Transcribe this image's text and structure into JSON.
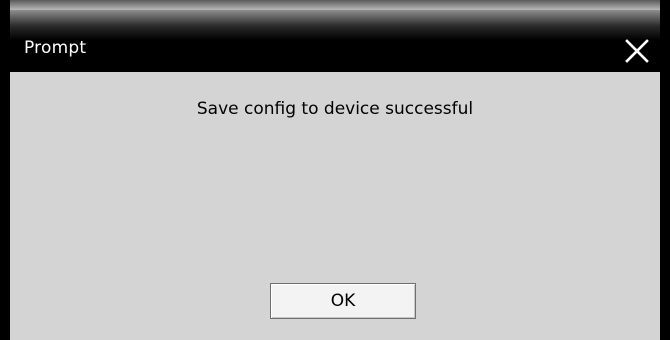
{
  "dialog": {
    "title": "Prompt",
    "close_icon": "close-icon",
    "message": "Save config to device successful",
    "ok_label": "OK"
  }
}
